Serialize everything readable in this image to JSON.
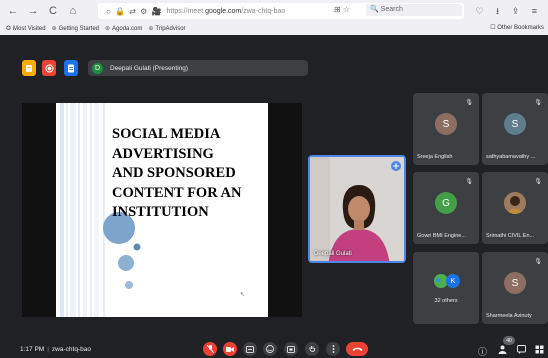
{
  "browser": {
    "nav": {
      "back": "←",
      "forward": "→",
      "reload": "C",
      "home": "⌂"
    },
    "url_icons": "○ 🔒 ⇄ ⚙ 🎥",
    "url_prefix": "https://meet.",
    "url_domain": "google.com",
    "url_suffix": "/zwa-chtq-bao",
    "url_right_icons": "⊞ ☆",
    "search_placeholder": "🔍 Search",
    "right_icons": "♡ ⭳ ⇪ ≡",
    "bookmarks": [
      {
        "icon": "✪",
        "label": "Most Visited"
      },
      {
        "icon": "⊕",
        "label": "Getting Started"
      },
      {
        "icon": "⊛",
        "label": "Agoda.com"
      },
      {
        "icon": "⊕",
        "label": "TripAdvisor"
      }
    ],
    "other_bookmarks": "☐ Other Bookmarks"
  },
  "meet": {
    "presenter_initial": "D",
    "presenter_label": "Deepali Gulati (Presenting)",
    "slide": {
      "title_lines": [
        "SOCIAL MEDIA",
        "ADVERTISING",
        "AND SPONSORED",
        "CONTENT FOR AN",
        "INSTITUTION"
      ]
    },
    "self": {
      "name": "Deepali Gulati"
    },
    "participants": [
      {
        "initial": "S",
        "name": "Sreeja English",
        "color": "#8d6e63"
      },
      {
        "initial": "S",
        "name": "sathyabamavathy ...",
        "color": "#607d8b"
      },
      {
        "initial": "G",
        "name": "Gowri BMI Engine...",
        "color": "#43a047"
      },
      {
        "initial": "",
        "name": "Srimathi CIVIL En...",
        "color": "#6d4c41"
      },
      {
        "initial": "K",
        "name": "32 others",
        "color": "#1a73e8"
      },
      {
        "initial": "S",
        "name": "Sharmeela Avinuty",
        "color": "#8d6e63"
      }
    ],
    "time": "1:17 PM",
    "meeting_code": "zwa-chtq-bao",
    "people_count": "40"
  },
  "colors": {
    "app_yellow": "#f9ab00",
    "app_red": "#ea4335",
    "app_blue": "#1a73e8",
    "accent_blue": "#4b86e8"
  }
}
